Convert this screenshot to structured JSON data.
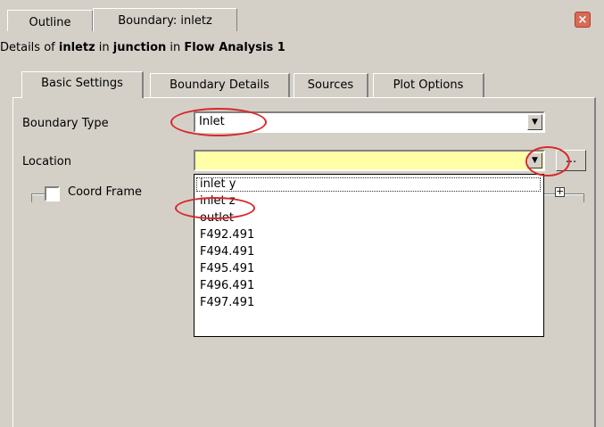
{
  "tabs": {
    "outline": "Outline",
    "boundary": "Boundary: inletz"
  },
  "close_icon": "×",
  "details": {
    "prefix": "Details of ",
    "object": "inletz",
    "mid1": " in ",
    "parent": "junction",
    "mid2": " in ",
    "analysis": "Flow Analysis 1"
  },
  "inner_tabs": {
    "basic": "Basic Settings",
    "boundary_details": "Boundary Details",
    "sources": "Sources",
    "plot_options": "Plot Options"
  },
  "form": {
    "boundary_type_label": "Boundary Type",
    "boundary_type_value": "Inlet",
    "location_label": "Location",
    "location_value": "",
    "ellipsis_label": "...",
    "coord_frame_label": "Coord Frame",
    "expand_symbol": "+"
  },
  "dropdown": {
    "items": [
      "inlet y",
      "inlet z",
      "outlet",
      "F492.491",
      "F494.491",
      "F495.491",
      "F496.491",
      "F497.491"
    ]
  },
  "colors": {
    "window_bg": "#d4d0c8",
    "location_field_bg": "#ffffa8",
    "annotation": "#d8282a"
  }
}
